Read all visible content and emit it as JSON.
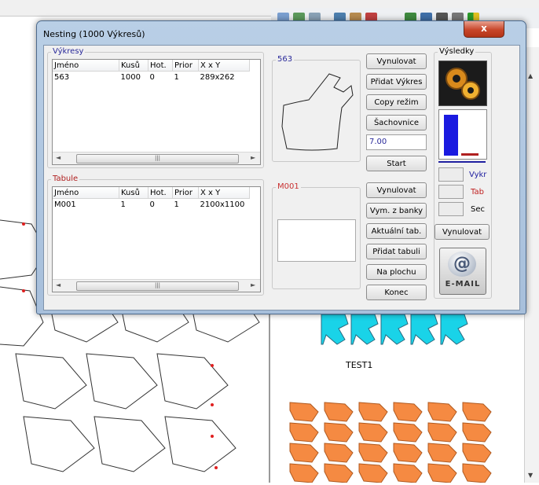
{
  "window": {
    "title": "Nesting  (1000 Výkresů)",
    "close_symbol": "x"
  },
  "vykresy": {
    "legend": "Výkresy",
    "columns": [
      "Jméno",
      "Kusů",
      "Hot.",
      "Prior",
      "X x Y"
    ],
    "rows": [
      [
        "563",
        "1000",
        "0",
        "1",
        "289x262"
      ]
    ]
  },
  "preview_top": {
    "label": "563",
    "label_color": "#2a2a9a"
  },
  "top_buttons": {
    "vynulovat": "Vynulovat",
    "pridat_vykres": "Přidat Výkres",
    "copy_rezim": "Copy režim",
    "sachovnice": "Šachovnice",
    "value": "7.00",
    "start": "Start"
  },
  "tabule": {
    "legend": "Tabule",
    "columns": [
      "Jméno",
      "Kusů",
      "Hot.",
      "Prior",
      "X x Y"
    ],
    "rows": [
      [
        "M001",
        "1",
        "0",
        "1",
        "2100x1100"
      ]
    ]
  },
  "preview_bottom": {
    "label": "M001",
    "label_color": "#c83030"
  },
  "bottom_buttons": {
    "vynulovat": "Vynulovat",
    "vym_z_banky": "Vym. z banky",
    "aktualni_tab": "Aktuální tab.",
    "pridat_tabuli": "Přidat tabuli",
    "na_plochu": "Na plochu",
    "konec": "Konec"
  },
  "vysledky": {
    "legend": "Výsledky",
    "icon": "gears-icon",
    "bar_colors": {
      "blue": "#1a1ae0",
      "red": "#b02020"
    },
    "vykr": "Vykr",
    "tab": "Tab",
    "sec": "Sec",
    "vykr_color": "#2020a0",
    "tab_color": "#c02020",
    "vynulovat": "Vynulovat",
    "email": "E-MAIL"
  },
  "background": {
    "test_label": "TEST1",
    "teal": "#19d3e8",
    "orange": "#f58a42"
  }
}
